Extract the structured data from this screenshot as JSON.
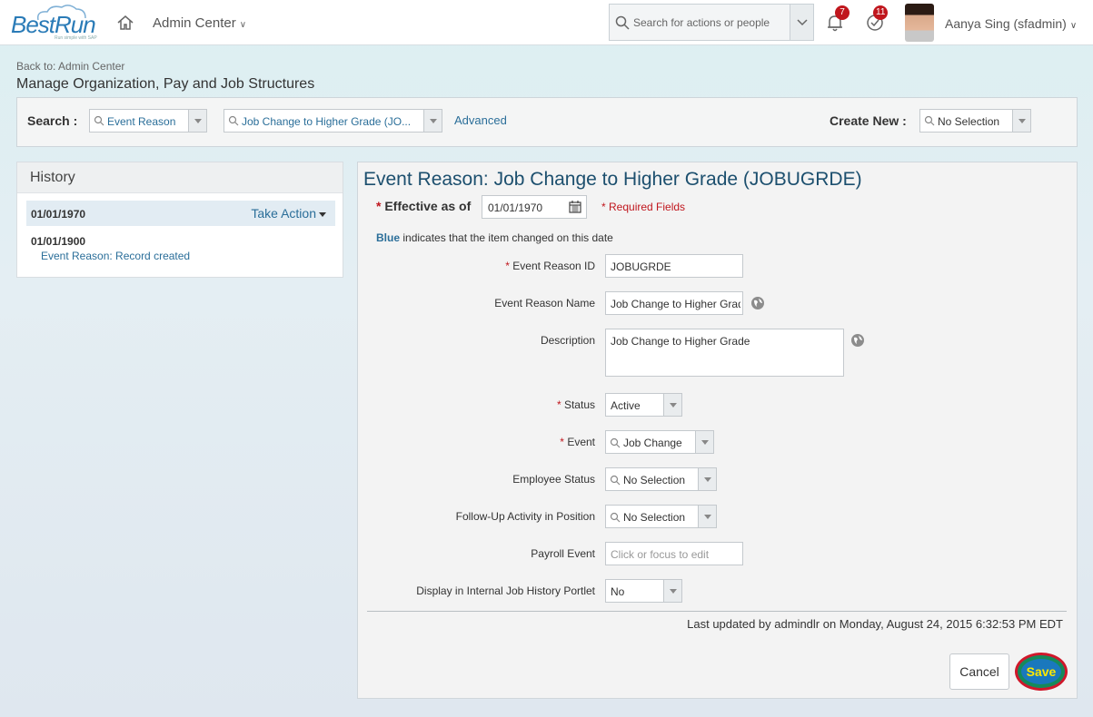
{
  "header": {
    "logo": "BestRun",
    "logo_tagline": "Run simple with SAP",
    "admin_menu": "Admin Center",
    "search_placeholder": "Search for actions or people",
    "notifications_count": "7",
    "todo_count": "11",
    "user_name": "Aanya Sing (sfadmin)"
  },
  "page": {
    "back_link": "Back to: Admin Center",
    "title": "Manage Organization, Pay and Job Structures"
  },
  "search_bar": {
    "label": "Search :",
    "type_value": "Event Reason",
    "item_value": "Job Change to Higher Grade (JO...",
    "advanced": "Advanced",
    "create_label": "Create New :",
    "create_value": "No Selection"
  },
  "history": {
    "title": "History",
    "entries": [
      {
        "date": "01/01/1970",
        "action": "Take Action"
      },
      {
        "date": "01/01/1900",
        "note": "Event Reason: Record created"
      }
    ]
  },
  "detail": {
    "title": "Event Reason: Job Change to Higher Grade (JOBUGRDE)",
    "effective_label": "Effective as of",
    "effective_date": "01/01/1970",
    "required_fields": "* Required Fields",
    "blue_word": "Blue",
    "blue_note": " indicates that the item changed on this date",
    "fields": {
      "event_reason_id_label": "Event Reason ID",
      "event_reason_id": "JOBUGRDE",
      "event_reason_name_label": "Event Reason Name",
      "event_reason_name": "Job Change to Higher Grade",
      "description_label": "Description",
      "description": "Job Change to Higher Grade",
      "status_label": "Status",
      "status": "Active",
      "event_label": "Event",
      "event": "Job Change",
      "employee_status_label": "Employee Status",
      "employee_status": "No Selection",
      "followup_label": "Follow-Up Activity in Position",
      "followup": "No Selection",
      "payroll_label": "Payroll Event",
      "payroll_placeholder": "Click or focus to edit",
      "display_label": "Display in Internal Job History Portlet",
      "display": "No"
    },
    "last_updated": "Last updated by admindlr on Monday, August 24, 2015 6:32:53 PM EDT",
    "cancel": "Cancel",
    "save": "Save"
  },
  "colors": {
    "accent": "#2a6e99",
    "required": "#c0161d",
    "save_button": "#1a78bd",
    "save_highlight": "#d0182a"
  }
}
